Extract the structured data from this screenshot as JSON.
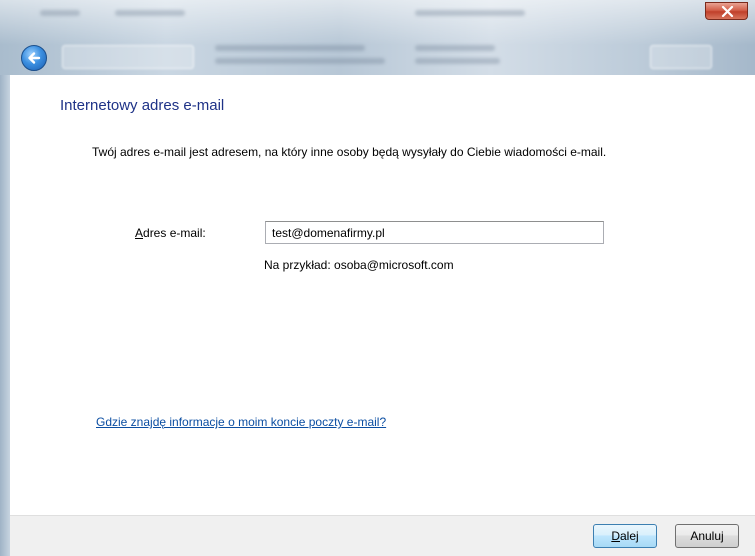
{
  "window": {
    "close_symbol": "✕"
  },
  "nav": {
    "back_icon": "back-arrow-icon"
  },
  "page": {
    "title": "Internetowy adres e-mail",
    "description": "Twój adres e-mail jest adresem, na który inne osoby będą wysyłały do Ciebie wiadomości e-mail."
  },
  "form": {
    "email_label_accel": "A",
    "email_label_rest": "dres e-mail:",
    "email_value": "test@domenafirmy.pl",
    "example_text": "Na przykład: osoba@microsoft.com"
  },
  "help": {
    "link_text": "Gdzie znajdę informacje o moim koncie poczty e-mail?"
  },
  "buttons": {
    "next_accel": "D",
    "next_rest": "alej",
    "cancel": "Anuluj"
  },
  "colors": {
    "title": "#1e3287",
    "link": "#0b4ea2",
    "footer_bg": "#f0f0f0",
    "close_red": "#c0402a"
  }
}
